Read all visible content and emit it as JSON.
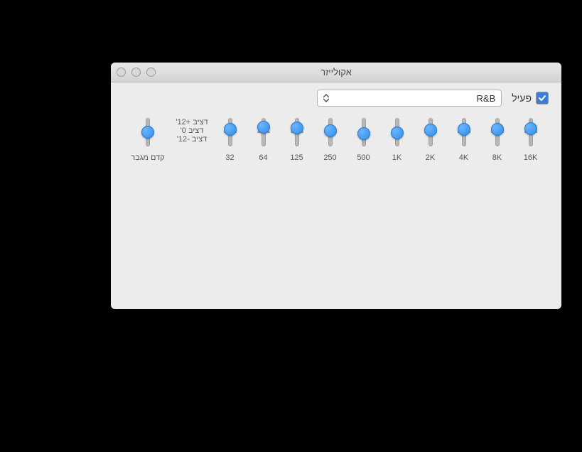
{
  "window": {
    "title": "אקולייזר"
  },
  "toolbar": {
    "active_label": "פעיל",
    "active_checked": true,
    "preset": "R&B"
  },
  "scale": {
    "top": "'דציב +12",
    "mid": "'דציב 0",
    "bottom": "'דציב -12"
  },
  "preamp": {
    "label": "קדם מגבר",
    "value": 0
  },
  "bands": [
    {
      "freq": "32",
      "db": 2.2
    },
    {
      "freq": "64",
      "db": 4.5
    },
    {
      "freq": "125",
      "db": 3.8
    },
    {
      "freq": "250",
      "db": 1.5
    },
    {
      "freq": "500",
      "db": -1.0
    },
    {
      "freq": "1K",
      "db": -0.6
    },
    {
      "freq": "2K",
      "db": 2.0
    },
    {
      "freq": "4K",
      "db": 2.3
    },
    {
      "freq": "8K",
      "db": 2.3
    },
    {
      "freq": "16K",
      "db": 2.8
    }
  ],
  "range": {
    "min": -12,
    "max": 12
  }
}
